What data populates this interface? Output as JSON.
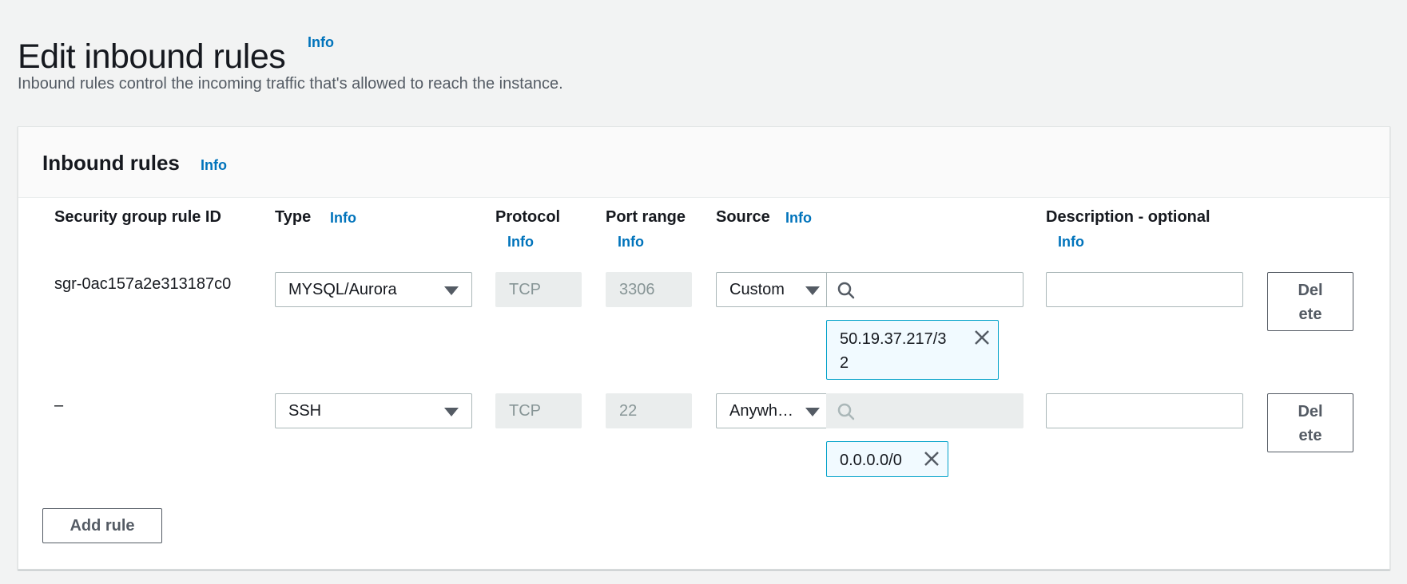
{
  "page": {
    "title": "Edit inbound rules",
    "title_info": "Info",
    "description": "Inbound rules control the incoming traffic that's allowed to reach the instance."
  },
  "panel": {
    "title": "Inbound rules",
    "info": "Info",
    "columns": {
      "rule_id": "Security group rule ID",
      "type": "Type",
      "type_info": "Info",
      "protocol": "Protocol",
      "protocol_info": "Info",
      "port_range": "Port range",
      "port_range_info": "Info",
      "source": "Source",
      "source_info": "Info",
      "description": "Description - optional",
      "description_info": "Info"
    },
    "rows": [
      {
        "rule_id": "sgr-0ac157a2e313187c0",
        "type": "MYSQL/Aurora",
        "protocol": "TCP",
        "port_range": "3306",
        "source_type": "Custom",
        "source_search_placeholder": "",
        "source_token_line1": "50.19.37.217/3",
        "source_token_line2": "2",
        "description": "",
        "delete_line1": "Del",
        "delete_line2": "ete"
      },
      {
        "rule_id": "–",
        "type": "SSH",
        "protocol": "TCP",
        "port_range": "22",
        "source_type": "Anywh…",
        "source_search_placeholder": "",
        "source_token": "0.0.0.0/0",
        "description": "",
        "delete_line1": "Del",
        "delete_line2": "ete"
      }
    ],
    "add_rule_label": "Add rule"
  },
  "colors": {
    "link": "#0073bb",
    "token_border": "#00a1c9",
    "token_bg": "#f1faff",
    "disabled_bg": "#eaeded"
  },
  "icons": {
    "select": "caret-down-icon",
    "search": "search-icon",
    "remove": "close-icon"
  }
}
